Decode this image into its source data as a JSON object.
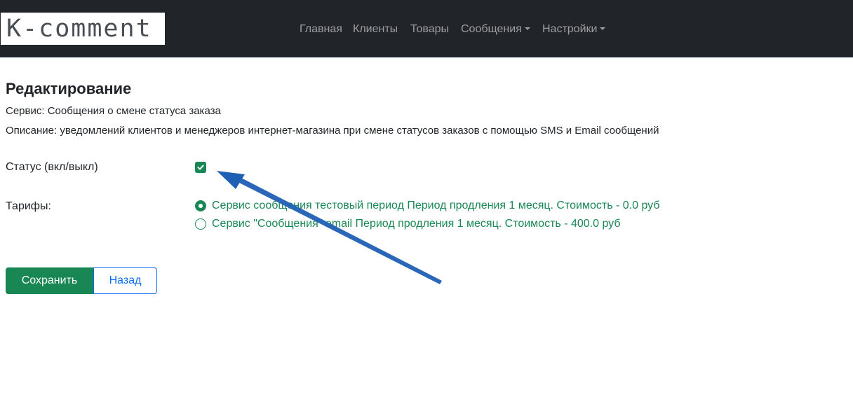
{
  "navbar": {
    "logo_text": "K-comment",
    "items": [
      {
        "label": "Главная"
      },
      {
        "label": "Клиенты"
      },
      {
        "label": "Товары"
      },
      {
        "label": "Сообщения"
      },
      {
        "label": "Настройки"
      }
    ]
  },
  "page": {
    "title": "Редактирование",
    "service": "Сервис: Сообщения о смене статуса заказа",
    "description": "Описание: уведомлений клиентов и менеджеров интернет-магазина при смене статусов заказов с помощью SMS и Email сообщений"
  },
  "form": {
    "status_label": "Статус (вкл/выкл)",
    "status_checked": true,
    "tariffs_label": "Тарифы:",
    "tariffs": [
      {
        "label": "Сервис сообщения тестовый период Период продления 1 месяц. Стоимость - 0.0 руб",
        "selected": true
      },
      {
        "label": "Сервис \"Сообщения\" email Период продления 1 месяц. Стоимость - 400.0 руб",
        "selected": false
      }
    ]
  },
  "buttons": {
    "save_label": "Сохранить",
    "back_label": "Назад"
  },
  "colors": {
    "navbar_bg": "#212529",
    "accent_green": "#198754",
    "link_blue": "#0d6efd",
    "annotation_arrow": "#1f5fb4"
  }
}
